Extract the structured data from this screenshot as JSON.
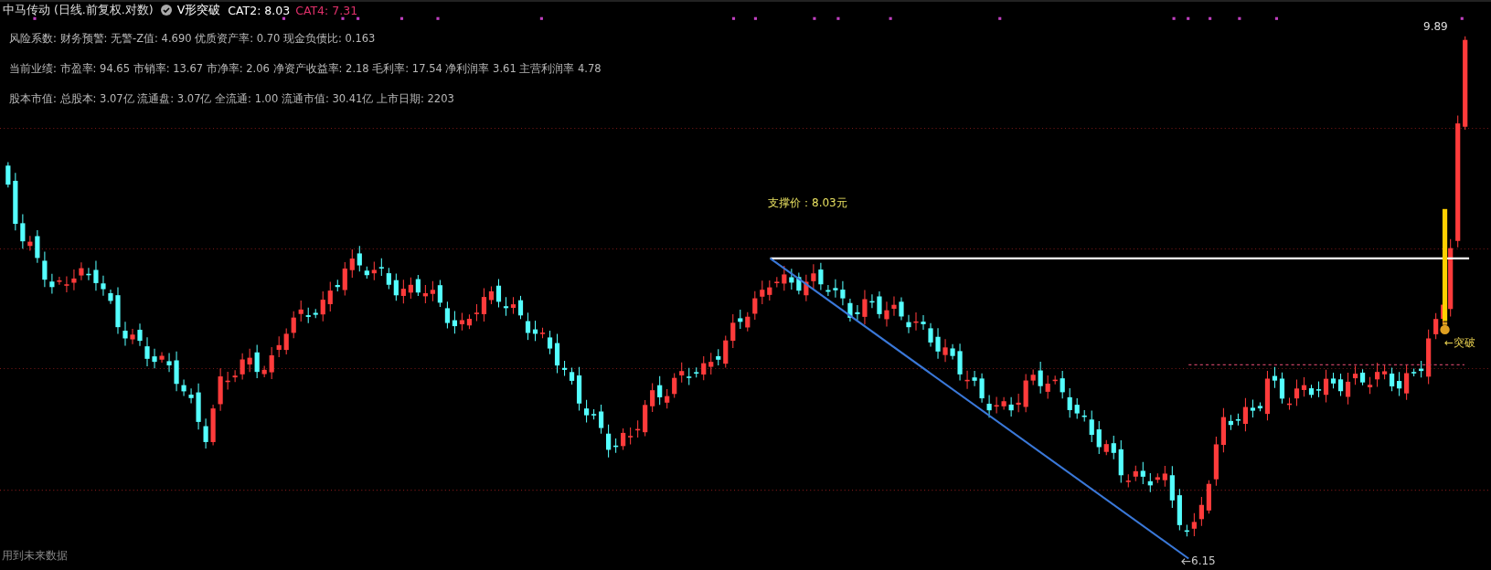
{
  "header": {
    "title": "中马传动 (日线.前复权.对数)",
    "indicator": "V形突破",
    "readings": [
      {
        "label": "CAT2:",
        "value": "8.03",
        "color": "#ffffff"
      },
      {
        "label": "CAT4:",
        "value": "7.31",
        "color": "#e0306a"
      }
    ]
  },
  "info_lines": [
    {
      "label": "风险系数:",
      "text": "财务预警: 无警-Z值: 4.690 优质资产率: 0.70 现金负债比: 0.163"
    },
    {
      "label": "当前业绩:",
      "text": "市盈率: 94.65 市销率: 13.67 市净率: 2.06 净资产收益率: 2.18 毛利率: 17.54 净利润率 3.61 主营利润率 4.78"
    },
    {
      "label": "股本市值:",
      "text": "总股本: 3.07亿 流通盘: 3.07亿 全流通: 1.00 流通市值: 30.41亿 上市日期: 2203"
    }
  ],
  "chart": {
    "support_label": "支撑价：8.03元",
    "high_label": "9.89",
    "low_label": "6.15",
    "breakout_label": "←突破"
  },
  "footer_note": "用到未来数据"
}
